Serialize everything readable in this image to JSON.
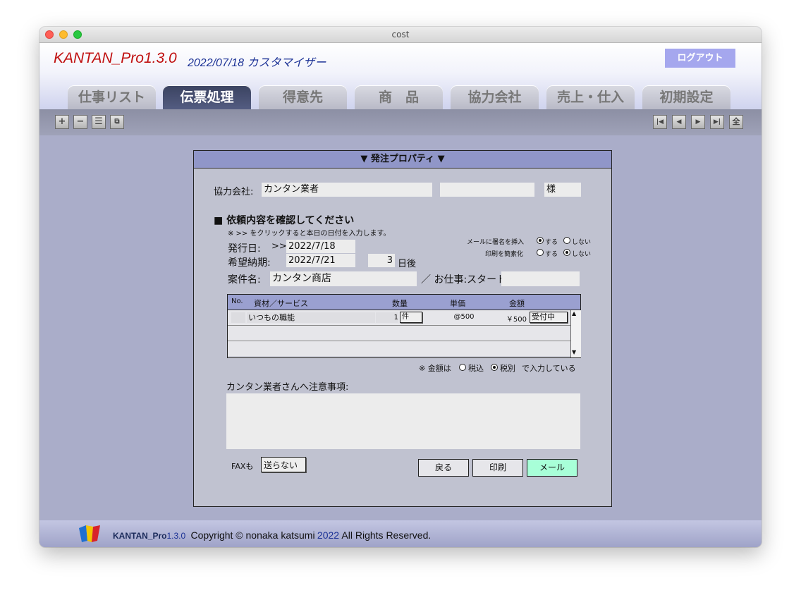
{
  "window": {
    "title": "cost"
  },
  "header": {
    "app_name": "KANTAN_Pro1.3.0",
    "date_user": "2022/07/18 カスタマイザー",
    "logout_label": "ログアウト"
  },
  "tabs": [
    {
      "label": "仕事リスト",
      "active": false
    },
    {
      "label": "伝票処理",
      "active": true
    },
    {
      "label": "得意先",
      "active": false
    },
    {
      "label": "商　品",
      "active": false
    },
    {
      "label": "協力会社",
      "active": false
    },
    {
      "label": "売上・仕入",
      "active": false
    },
    {
      "label": "初期設定",
      "active": false
    }
  ],
  "toolbar": {
    "left_buttons": [
      "plus-icon",
      "minus-icon",
      "list-icon",
      "duplicate-icon"
    ],
    "right_buttons": [
      {
        "icon": "first-record-icon",
        "label": ""
      },
      {
        "icon": "previous-record-icon",
        "label": ""
      },
      {
        "icon": "next-record-icon",
        "label": ""
      },
      {
        "icon": "last-record-icon",
        "label": ""
      },
      {
        "icon": "all-records-icon",
        "label": "全"
      }
    ]
  },
  "panel": {
    "title": "▼ 発注プロパティ ▼",
    "partner_label": "協力会社:",
    "partner_name": "カンタン業者",
    "partner_extra": "",
    "honorific": "様",
    "section_title": "■ 依頼内容を確認してください",
    "note": "※ >> をクリックすると本日の日付を入力します。",
    "issue_date_label": "発行日:",
    "issue_date_button": ">>",
    "issue_date": "2022/7/18",
    "due_date_label": "希望納期:",
    "due_date": "2022/7/21",
    "days_after": "3",
    "days_after_unit": "日後",
    "mail_signature_label": "メールに署名を挿入",
    "print_simplify_label": "印刷を簡素化",
    "option_yes": "する",
    "option_no": "しない",
    "mail_signature": "する",
    "print_simplify": "しない",
    "project_label": "案件名:",
    "project_name": "カンタン商店",
    "job_label": "／ お仕事:スタート",
    "job_value": "",
    "table": {
      "headers": {
        "no": "No.",
        "item": "資材／サービス",
        "qty": "数量",
        "unit_price": "単価",
        "amount": "金額"
      },
      "rows": [
        {
          "no": "",
          "item": "いつもの職能",
          "qty": "1",
          "unit": "件",
          "unit_price": "@500",
          "amount": "￥500",
          "status": "受付中"
        }
      ]
    },
    "tax_note_prefix": "※ 金額は",
    "tax_incl": "税込",
    "tax_excl": "税別",
    "tax_selected": "税別",
    "tax_note_suffix": "で入力している",
    "caution_label": "カンタン業者さんへ注意事項:",
    "caution_text": "",
    "fax_label": "FAXも",
    "fax_value": "送らない",
    "back_button": "戻る",
    "print_button": "印刷",
    "mail_button": "メール"
  },
  "footer": {
    "app_name": "KANTAN_Pro",
    "version": "1.3.0",
    "copyright_prefix": "Copyright © nonaka katsumi",
    "year": "2022",
    "rights": "All Rights Reserved."
  },
  "colors": {
    "brand_red": "#c01010",
    "brand_blue": "#1c3296",
    "mail_button": "#a8ffd8",
    "active_tab": "#3b4361"
  }
}
